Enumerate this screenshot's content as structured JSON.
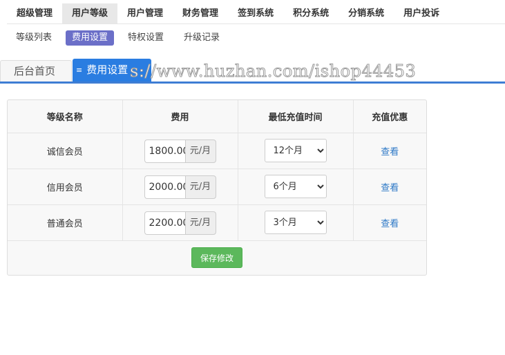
{
  "topnav": {
    "items": [
      {
        "label": "超级管理",
        "active": false
      },
      {
        "label": "用户等级",
        "active": true
      },
      {
        "label": "用户管理",
        "active": false
      },
      {
        "label": "财务管理",
        "active": false
      },
      {
        "label": "签到系统",
        "active": false
      },
      {
        "label": "积分系统",
        "active": false
      },
      {
        "label": "分销系统",
        "active": false
      },
      {
        "label": "用户投诉",
        "active": false
      }
    ]
  },
  "subnav": {
    "items": [
      {
        "label": "等级列表",
        "active": false
      },
      {
        "label": "费用设置",
        "active": true
      },
      {
        "label": "特权设置",
        "active": false
      },
      {
        "label": "升级记录",
        "active": false
      }
    ]
  },
  "tabs": {
    "home_label": "后台首页",
    "current_label": "费用设置",
    "current_icon": "list-icon",
    "watermark": "s://www.huzhan.com/ishop44453"
  },
  "colors": {
    "accent_tab": "#2a7de1",
    "active_sub": "#6b6fc8",
    "save_button": "#5cb85c",
    "link": "#2d78c6"
  },
  "table": {
    "headers": [
      "等级名称",
      "费用",
      "最低充值时间",
      "充值优惠"
    ],
    "unit": "元/月",
    "rows": [
      {
        "name": "诚信会员",
        "fee": "1800.00",
        "period": "12个月",
        "action": "查看"
      },
      {
        "name": "信用会员",
        "fee": "2000.00",
        "period": "6个月",
        "action": "查看"
      },
      {
        "name": "普通会员",
        "fee": "2200.00",
        "period": "3个月",
        "action": "查看"
      }
    ],
    "save_label": "保存修改"
  }
}
